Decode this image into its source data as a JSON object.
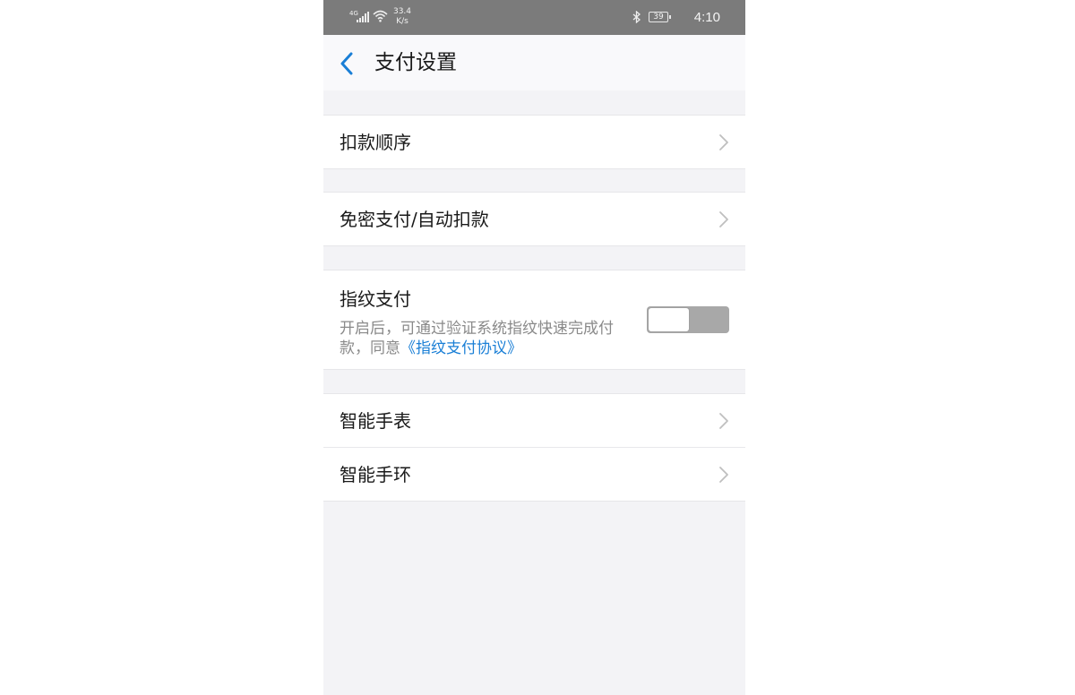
{
  "status_bar": {
    "network": "4G",
    "speed_value": "33.4",
    "speed_unit": "K/s",
    "battery": "39",
    "time": "4:10"
  },
  "header": {
    "title": "支付设置",
    "back_icon": "chevron-left-icon"
  },
  "settings": {
    "deduction_order": "扣款顺序",
    "password_free": "免密支付/自动扣款",
    "fingerprint": {
      "title": "指纹支付",
      "description": "开启后，可通过验证系统指纹快速完成付款，同意",
      "agreement_link": "《指纹支付协议》",
      "enabled": false
    },
    "smart_watch": "智能手表",
    "smart_band": "智能手环"
  },
  "colors": {
    "accent": "#1a7fd6",
    "status_bar": "#7b7b7b",
    "page_background": "#f3f3f6"
  }
}
